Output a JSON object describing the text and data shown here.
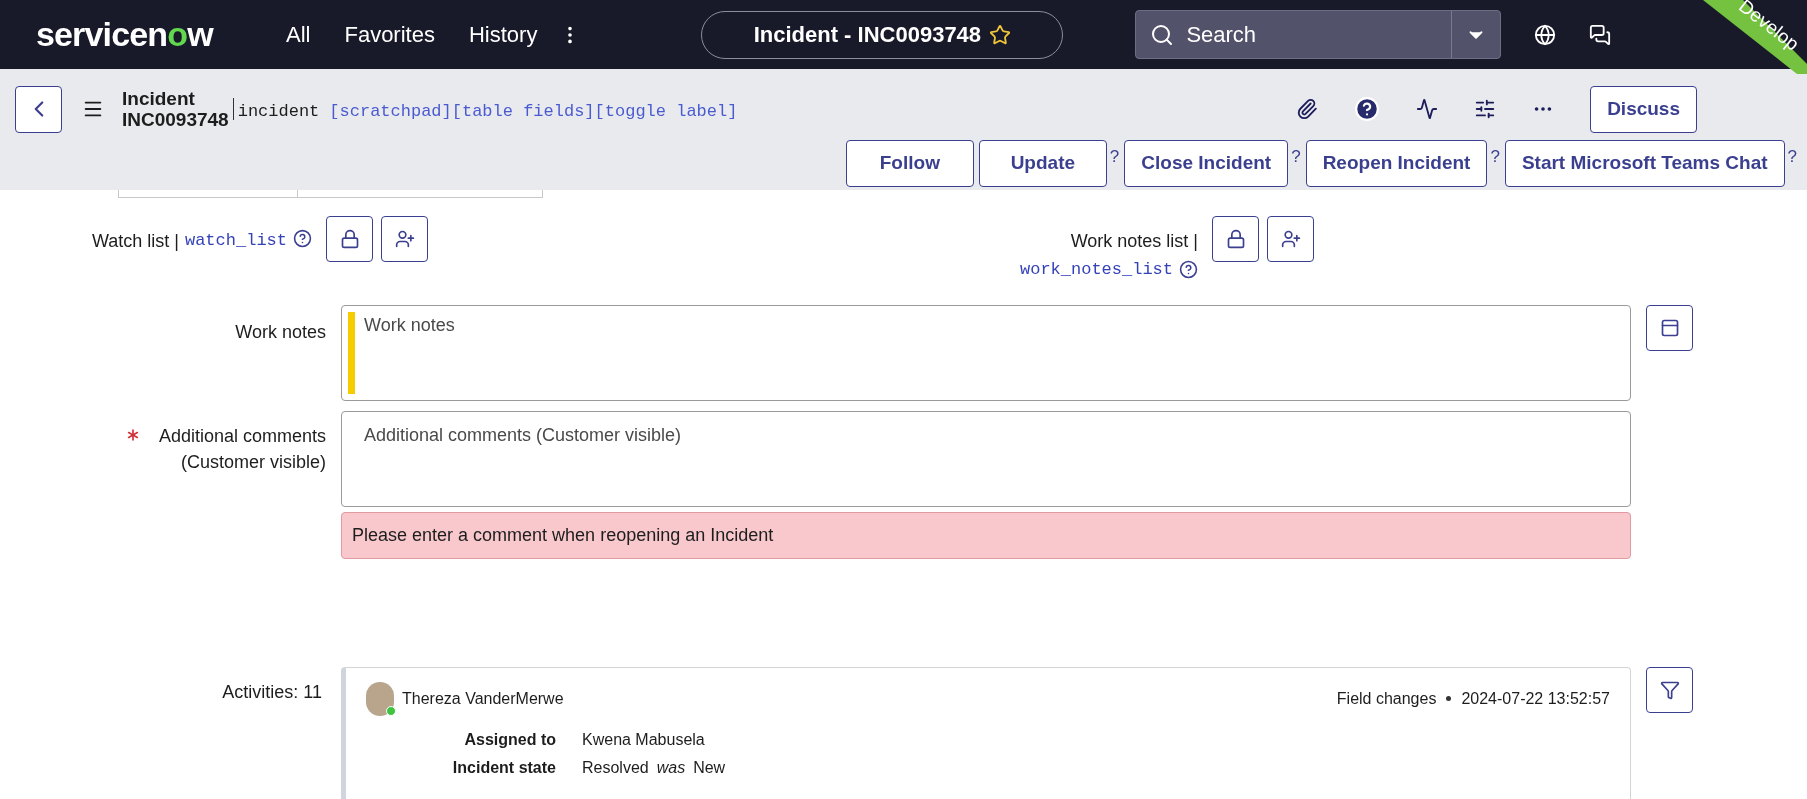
{
  "nav": {
    "logo": "servicenow",
    "menu": [
      "All",
      "Favorites",
      "History"
    ],
    "record_pill": {
      "title": "Incident - INC0093748",
      "favorite": false
    },
    "search": {
      "placeholder": "Search"
    },
    "instance_banner": "Develop"
  },
  "header": {
    "title": "Incident",
    "number": "INC0093748",
    "table_name": "incident",
    "links": [
      "[scratchpad]",
      "[table fields]",
      "[toggle label]"
    ],
    "discuss_button": "Discuss",
    "actions": [
      {
        "label": "Follow"
      },
      {
        "label": "Update",
        "help": "?"
      },
      {
        "label": "Close Incident",
        "help": "?"
      },
      {
        "label": "Reopen Incident",
        "help": "?"
      },
      {
        "label": "Start Microsoft Teams Chat",
        "help": "?"
      }
    ]
  },
  "form": {
    "watch_list": {
      "label": "Watch list |",
      "field_name": "watch_list"
    },
    "work_notes_list": {
      "label": "Work notes list |",
      "field_name": "work_notes_list"
    },
    "work_notes": {
      "label": "Work notes",
      "placeholder": "Work notes"
    },
    "additional_comments": {
      "label": "Additional comments (Customer visible)",
      "placeholder": "Additional comments (Customer visible)",
      "mandatory": true,
      "error": "Please enter a comment when reopening an Incident"
    },
    "activities": {
      "label": "Activities: 11",
      "entries": [
        {
          "author": "Thereza VanderMerwe",
          "online": true,
          "type": "Field changes",
          "time": "2024-07-22 13:52:57",
          "changes": [
            {
              "field": "Assigned to",
              "value": "Kwena Mabusela"
            },
            {
              "field": "Incident state",
              "value": "Resolved",
              "was_label": "was",
              "previous": "New"
            }
          ]
        }
      ]
    }
  }
}
